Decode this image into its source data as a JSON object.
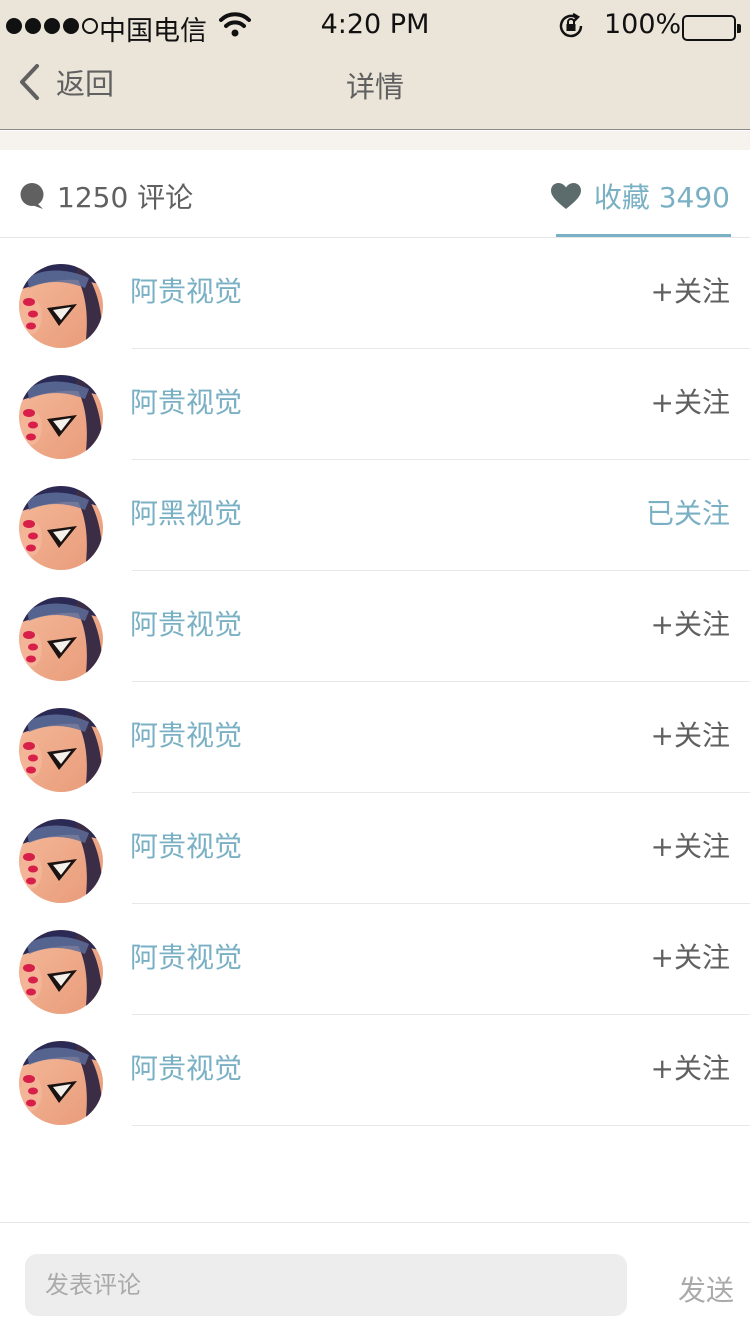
{
  "status_bar": {
    "carrier": "中国电信",
    "time": "4:20 PM",
    "battery": "100%"
  },
  "nav": {
    "back_label": "返回",
    "title": "详情"
  },
  "stats": {
    "comments": "1250 评论",
    "favorites": "收藏 3490",
    "active_tab": "favorites",
    "accent_color": "#7ab0c4"
  },
  "users": [
    {
      "name": "阿贵视觉",
      "follow": "+关注",
      "followed": false
    },
    {
      "name": "阿贵视觉",
      "follow": "+关注",
      "followed": false
    },
    {
      "name": "阿黑视觉",
      "follow": "已关注",
      "followed": true
    },
    {
      "name": "阿贵视觉",
      "follow": "+关注",
      "followed": false
    },
    {
      "name": "阿贵视觉",
      "follow": "+关注",
      "followed": false
    },
    {
      "name": "阿贵视觉",
      "follow": "+关注",
      "followed": false
    },
    {
      "name": "阿贵视觉",
      "follow": "+关注",
      "followed": false
    },
    {
      "name": "阿贵视觉",
      "follow": "+关注",
      "followed": false
    }
  ],
  "comment_bar": {
    "placeholder": "发表评论",
    "send_label": "发送"
  }
}
